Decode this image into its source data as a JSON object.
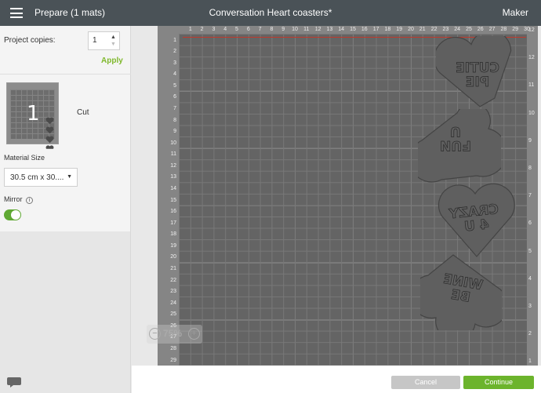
{
  "header": {
    "title": "Prepare (1 mats)",
    "document_name": "Conversation Heart coasters*",
    "machine": "Maker",
    "background": "#4a5257"
  },
  "project": {
    "copies_label": "Project copies:",
    "copies_value": "1",
    "apply_label": "Apply"
  },
  "mat_list": [
    {
      "number": "1",
      "mode": "Cut"
    }
  ],
  "material_size": {
    "label": "Material Size",
    "value": "30.5 cm x 30...."
  },
  "mirror": {
    "label": "Mirror",
    "info_icon": "i",
    "enabled": true
  },
  "ruler": {
    "top": [
      "1",
      "2",
      "3",
      "4",
      "5",
      "6",
      "7",
      "8",
      "9",
      "10",
      "11",
      "12",
      "13",
      "14",
      "15",
      "16",
      "17",
      "18",
      "19",
      "20",
      "21",
      "22",
      "23",
      "24",
      "25",
      "26",
      "27",
      "28",
      "29",
      "30"
    ],
    "left": [
      "1",
      "2",
      "3",
      "4",
      "5",
      "6",
      "7",
      "8",
      "9",
      "10",
      "11",
      "12",
      "13",
      "14",
      "15",
      "16",
      "17",
      "18",
      "19",
      "20",
      "21",
      "22",
      "23",
      "24",
      "25",
      "26",
      "27",
      "28",
      "29"
    ],
    "right": [
      "12",
      "11",
      "10",
      "9",
      "8",
      "7",
      "6",
      "5",
      "4",
      "3",
      "2",
      "1"
    ],
    "top_right_corner": "12"
  },
  "hearts": [
    {
      "line1": "CUTIE",
      "line2": "PIE"
    },
    {
      "line1": "U",
      "line2": "FUN"
    },
    {
      "line1": "CRAZY",
      "line2": "4 U"
    },
    {
      "line1": "WINE",
      "line2": "BE"
    }
  ],
  "zoom": {
    "value": "75%",
    "minus": "−",
    "plus": "+"
  },
  "footer": {
    "cancel_label": "Cancel",
    "continue_label": "Continue",
    "accent": "#6cb42c"
  }
}
